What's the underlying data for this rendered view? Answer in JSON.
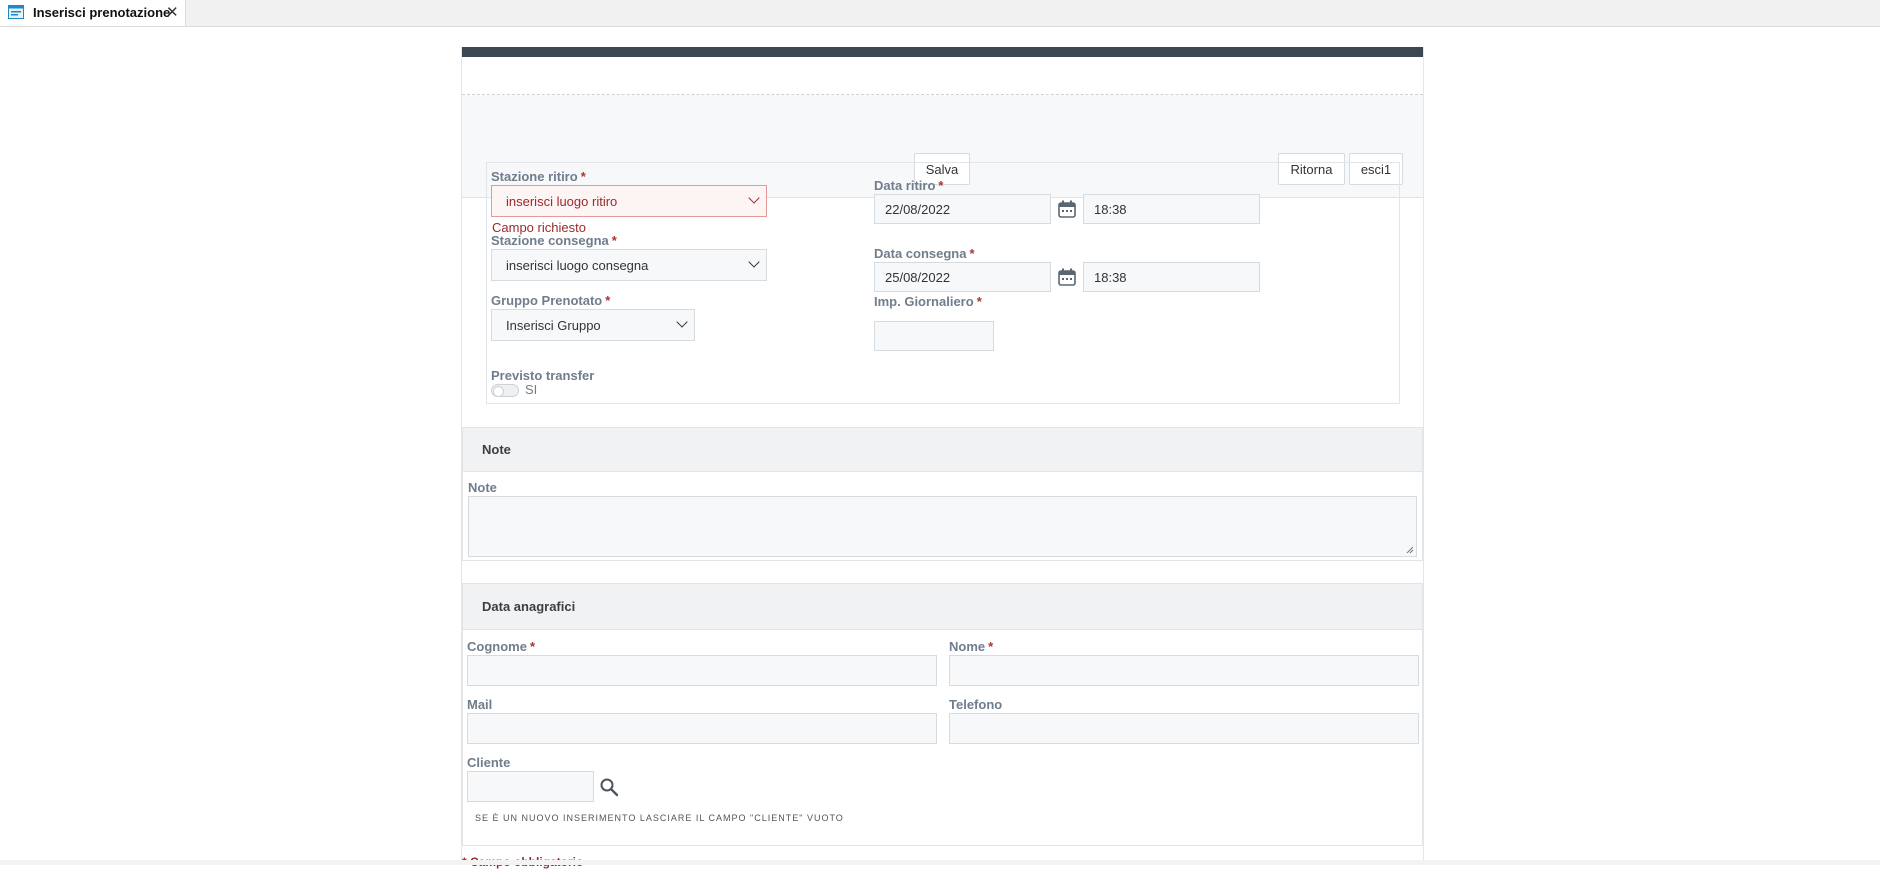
{
  "tab": {
    "title": "Inserisci prenotazione",
    "close_symbol": "✕"
  },
  "toolbar": {
    "save_label": "Salva",
    "back_label": "Ritorna",
    "exit_label": "esci1"
  },
  "required_marker": "*",
  "booking": {
    "pickup_station": {
      "label": "Stazione ritiro",
      "value": "inserisci luogo ritiro",
      "error": "Campo richiesto"
    },
    "pickup_date": {
      "label": "Data ritiro",
      "date": "22/08/2022",
      "time": "18:38"
    },
    "return_station": {
      "label": "Stazione consegna",
      "value": "inserisci luogo consegna"
    },
    "return_date": {
      "label": "Data consegna",
      "date": "25/08/2022",
      "time": "18:38"
    },
    "group": {
      "label": "Gruppo Prenotato",
      "value": "Inserisci Gruppo"
    },
    "daily_amount": {
      "label": "Imp. Giornaliero",
      "value": ""
    },
    "transfer": {
      "label": "Previsto transfer",
      "toggle_text": "SI"
    }
  },
  "notes": {
    "section_title": "Note",
    "field_label": "Note",
    "value": ""
  },
  "personal": {
    "section_title": "Data anagrafici",
    "surname_label": "Cognome",
    "name_label": "Nome",
    "mail_label": "Mail",
    "phone_label": "Telefono",
    "client_label": "Cliente",
    "client_hint": "SE È UN NUOVO INSERIMENTO LASCIARE IL CAMPO \"CLIENTE\" VUOTO"
  },
  "footnote": "* Campo obbligatorio",
  "colors": {
    "header_bar": "#3c4751",
    "error": "#9b2a2a",
    "label": "#6f7d8c",
    "tab_icon": "#1e88c8"
  }
}
